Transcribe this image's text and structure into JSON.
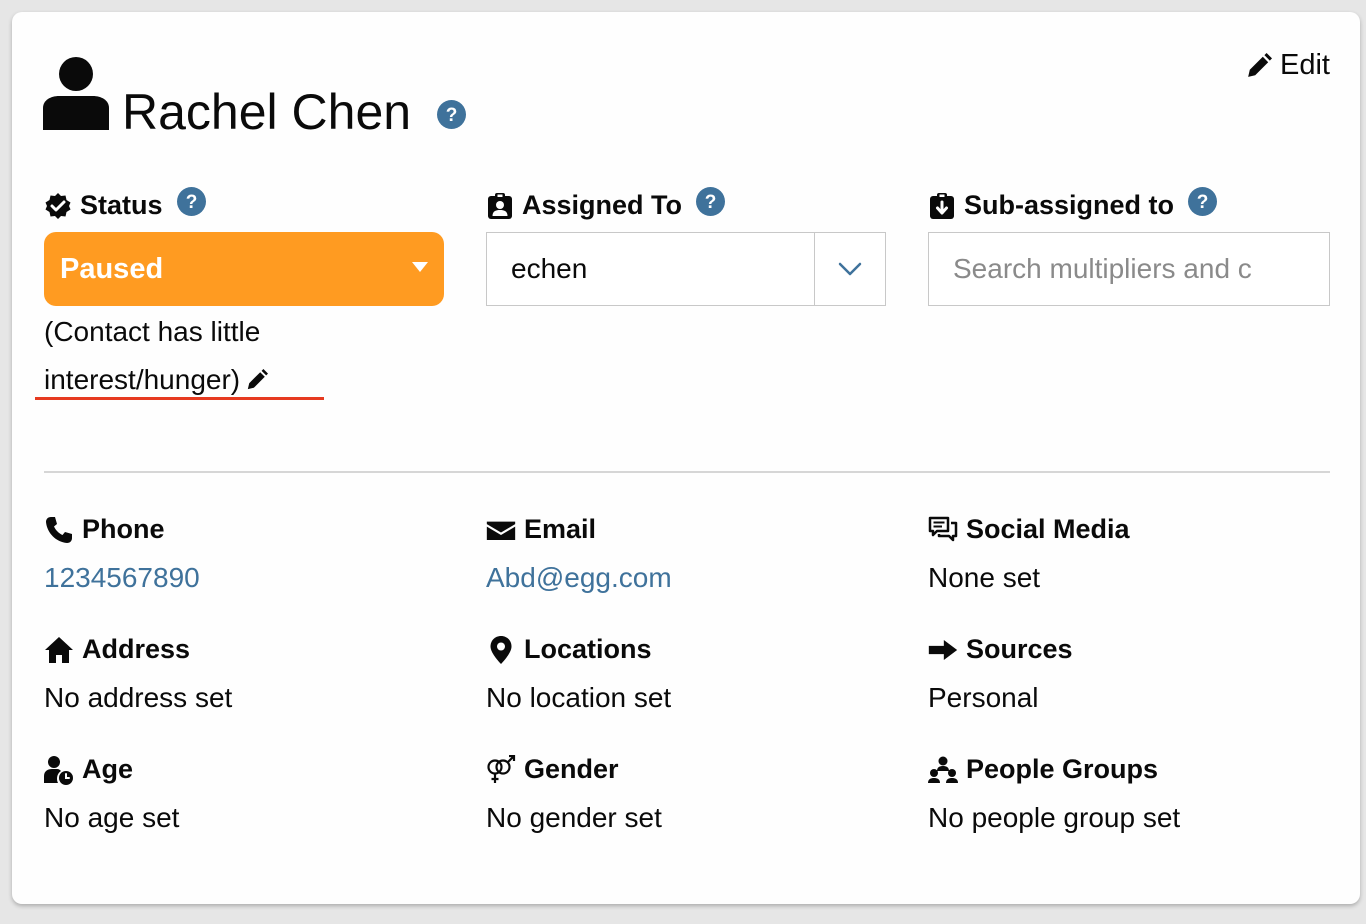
{
  "contact": {
    "name": "Rachel Chen",
    "edit_label": "Edit"
  },
  "status": {
    "label": "Status",
    "value": "Paused",
    "description": "(Contact has little interest/hunger)",
    "color": "#ff9b21"
  },
  "assigned_to": {
    "label": "Assigned To",
    "value": "echen"
  },
  "sub_assigned": {
    "label": "Sub-assigned to",
    "placeholder": "Search multipliers and c"
  },
  "details": [
    {
      "label": "Phone",
      "value": "1234567890",
      "icon": "phone-icon",
      "is_link": true
    },
    {
      "label": "Email",
      "value": "Abd@egg.com",
      "icon": "email-icon",
      "is_link": true
    },
    {
      "label": "Social Media",
      "value": "None set",
      "icon": "social-media-icon",
      "is_link": false
    },
    {
      "label": "Address",
      "value": "No address set",
      "icon": "home-icon",
      "is_link": false
    },
    {
      "label": "Locations",
      "value": "No location set",
      "icon": "map-pin-icon",
      "is_link": false
    },
    {
      "label": "Sources",
      "value": "Personal",
      "icon": "arrow-right-icon",
      "is_link": false
    },
    {
      "label": "Age",
      "value": "No age set",
      "icon": "age-icon",
      "is_link": false
    },
    {
      "label": "Gender",
      "value": "No gender set",
      "icon": "gender-icon",
      "is_link": false
    },
    {
      "label": "People Groups",
      "value": "No people group set",
      "icon": "people-groups-icon",
      "is_link": false
    }
  ],
  "colors": {
    "help_icon": "#3f729b",
    "link": "#3f729b",
    "underline": "#e63a20"
  }
}
